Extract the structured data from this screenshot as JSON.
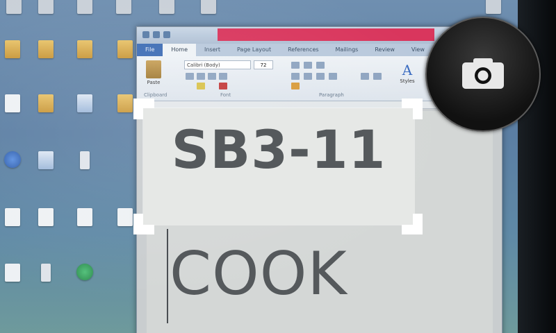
{
  "scan_text": "SB3-11",
  "document_text": "COOK",
  "word": {
    "tabs": [
      "File",
      "Home",
      "Insert",
      "Page Layout",
      "References",
      "Mailings",
      "Review",
      "View"
    ],
    "font_name": "Calibri (Body)",
    "font_size": "72",
    "paste_label": "Paste",
    "styles_label": "Styles",
    "group_labels": [
      "Clipboard",
      "Font",
      "Paragraph"
    ]
  },
  "colors": {
    "title_bar": "#d9365d",
    "shutter": "#111111"
  },
  "icons": {
    "shutter": "camera-icon"
  }
}
